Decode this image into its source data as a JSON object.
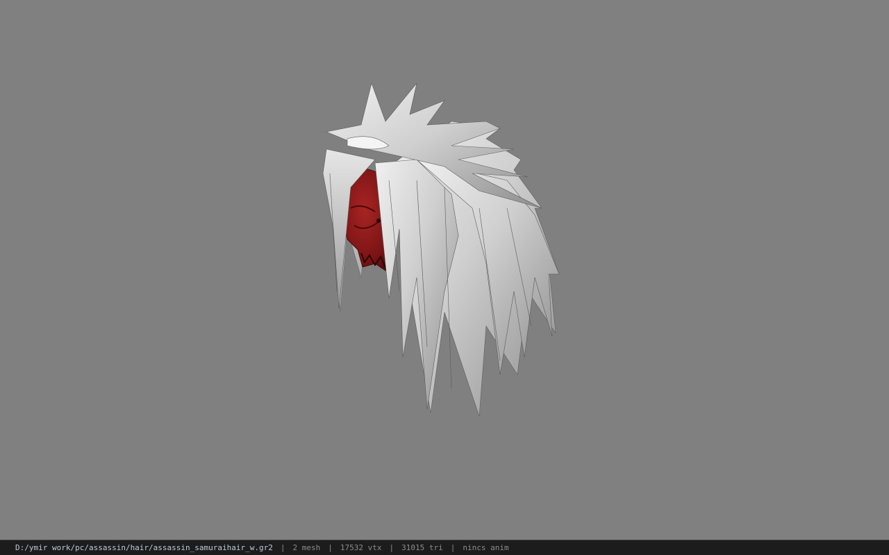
{
  "viewport": {
    "background_color": "#808080",
    "model": {
      "name": "samurai-hair-with-demon-mask",
      "hair_color": "#c8c8c8",
      "mask_color": "#8c1a1a"
    }
  },
  "statusbar": {
    "file_path": "D:/ymir work/pc/assassin/hair/assassin_samuraihair_w.gr2",
    "separator": "|",
    "mesh_count": "2 mesh",
    "vertex_count": "17532 vtx",
    "triangle_count": "31015 tri",
    "animation": "nincs anim"
  }
}
